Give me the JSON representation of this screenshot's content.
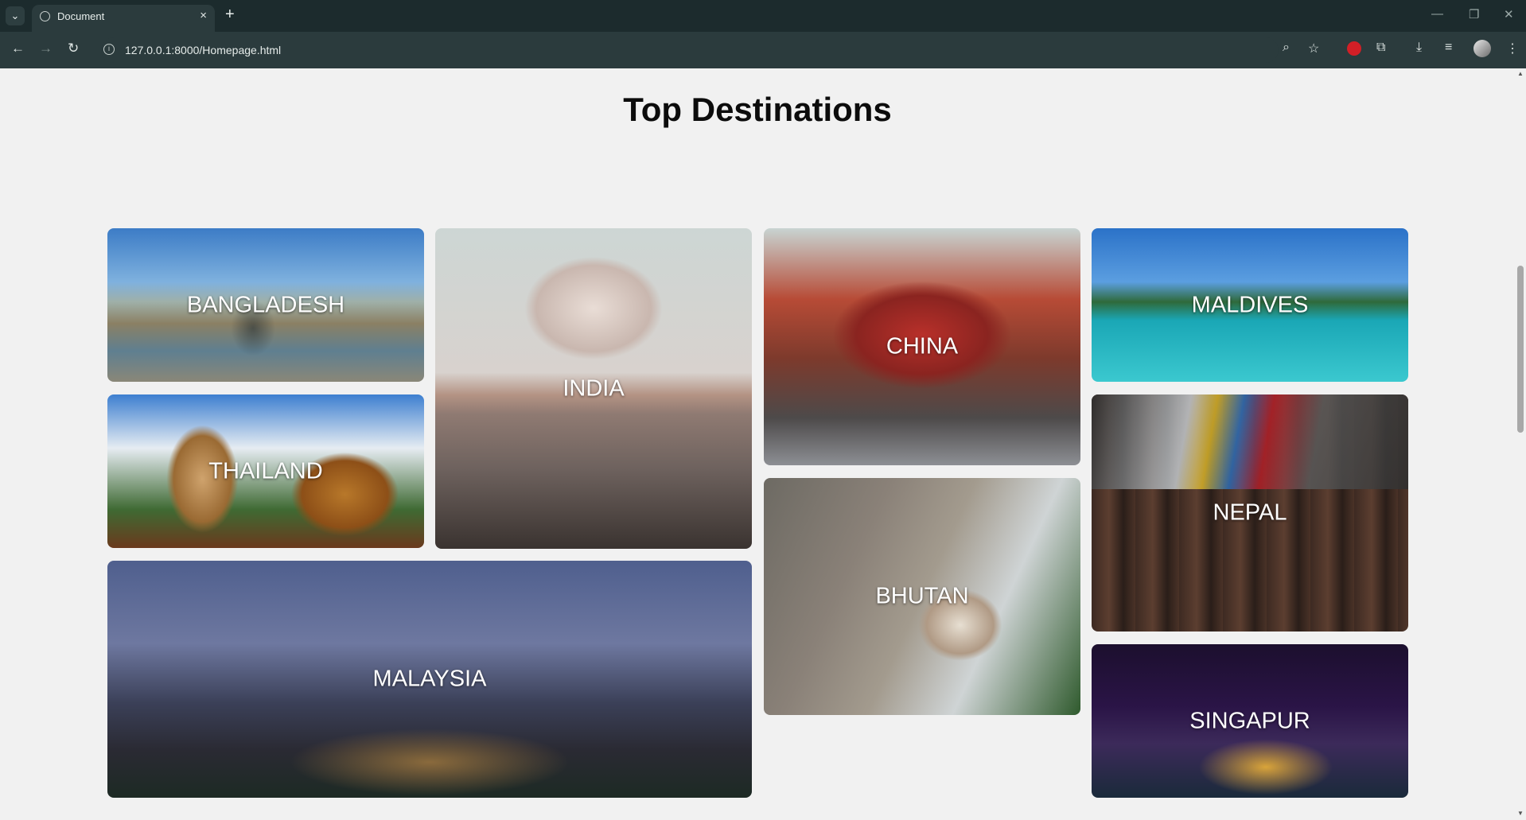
{
  "browser": {
    "tab_title": "Document",
    "url": "127.0.0.1:8000/Homepage.html",
    "new_tab_label": "+",
    "close_tab_label": "×"
  },
  "page": {
    "heading": "Top Destinations",
    "destinations": [
      {
        "name": "BANGLADESH"
      },
      {
        "name": "INDIA"
      },
      {
        "name": "CHINA"
      },
      {
        "name": "MALDIVES"
      },
      {
        "name": "THAILAND"
      },
      {
        "name": "NEPAL"
      },
      {
        "name": "BHUTAN"
      },
      {
        "name": "MALAYSIA"
      },
      {
        "name": "SINGAPUR"
      }
    ]
  }
}
